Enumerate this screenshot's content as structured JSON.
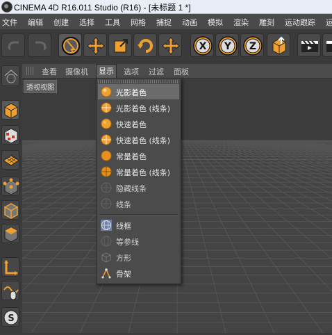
{
  "window": {
    "title": "CINEMA 4D R16.011 Studio (R16) - [未标题 1 *]"
  },
  "menubar": {
    "items": [
      "文件",
      "编辑",
      "创建",
      "选择",
      "工具",
      "网格",
      "捕捉",
      "动画",
      "模拟",
      "渲染",
      "雕刻",
      "运动跟踪",
      "运动"
    ]
  },
  "toolbar": {
    "tools": [
      {
        "name": "undo-icon"
      },
      {
        "name": "redo-icon"
      },
      {
        "name": "live-selection-icon"
      },
      {
        "name": "move-icon"
      },
      {
        "name": "scale-icon"
      },
      {
        "name": "rotate-icon"
      },
      {
        "name": "recent-tool-icon"
      },
      {
        "name": "x-axis-lock-icon",
        "label": "X"
      },
      {
        "name": "y-axis-lock-icon",
        "label": "Y"
      },
      {
        "name": "z-axis-lock-icon",
        "label": "Z"
      },
      {
        "name": "coordinate-system-icon"
      },
      {
        "name": "render-view-icon"
      },
      {
        "name": "render-to-picture-viewer-icon"
      }
    ]
  },
  "viewport": {
    "menus": [
      "查看",
      "摄像机",
      "显示",
      "选项",
      "过滤",
      "面板"
    ],
    "active_menu": "显示",
    "label": "透视视图"
  },
  "display_menu": {
    "items": [
      {
        "label": "光影着色",
        "icon": "gouraud-shading-icon",
        "selected": true
      },
      {
        "label": "光影着色 (线条)",
        "icon": "gouraud-shading-lines-icon"
      },
      {
        "label": "快速着色",
        "icon": "quick-shading-icon"
      },
      {
        "label": "快速着色 (线条)",
        "icon": "quick-shading-lines-icon"
      },
      {
        "label": "常量着色",
        "icon": "constant-shading-icon"
      },
      {
        "label": "常量着色 (线条)",
        "icon": "constant-shading-lines-icon"
      },
      {
        "label": "隐藏线条",
        "icon": "hidden-line-icon"
      },
      {
        "label": "线条",
        "icon": "lines-icon"
      }
    ],
    "items2": [
      {
        "label": "线框",
        "icon": "wireframe-icon",
        "checked": true
      },
      {
        "label": "等参线",
        "icon": "isoparms-icon"
      },
      {
        "label": "方形",
        "icon": "box-icon"
      },
      {
        "label": "骨架",
        "icon": "skeleton-icon"
      }
    ]
  },
  "colors": {
    "accent_orange": "#f0a030",
    "menu_selected": "#6b6b6b",
    "viewport_bg": "#3e3e3e"
  }
}
